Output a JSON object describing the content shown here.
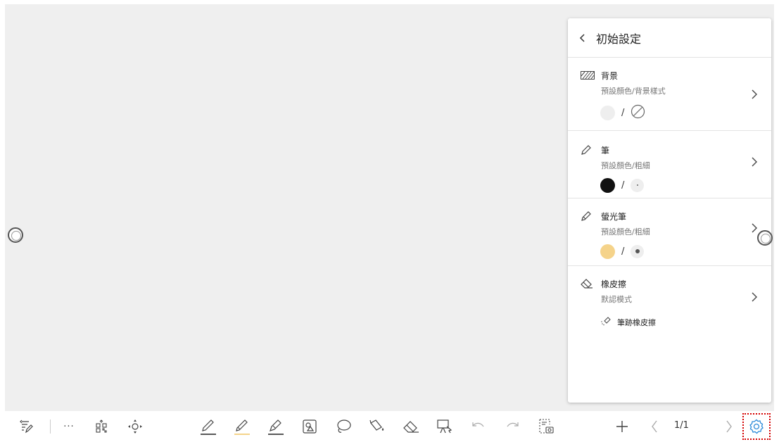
{
  "panel": {
    "title": "初始設定",
    "background": {
      "title": "背景",
      "subtitle": "預設顏色/背景樣式",
      "slash": "/"
    },
    "pen": {
      "title": "筆",
      "subtitle": "預設顏色/粗細",
      "slash": "/"
    },
    "highlighter": {
      "title": "螢光筆",
      "subtitle": "預設顏色/粗細",
      "slash": "/"
    },
    "eraser": {
      "title": "橡皮擦",
      "subtitle": "默認模式",
      "option": "筆跡橡皮擦"
    }
  },
  "toolbar": {
    "page_indicator": "1/1",
    "more_label": "···"
  },
  "colors": {
    "pen": "#111111",
    "highlighter": "#f5d38a",
    "background_swatch": "#eeeeee",
    "focus": "#d40000"
  },
  "icons": [
    "back-icon",
    "background-pattern-icon",
    "pen-icon",
    "highlighter-icon",
    "eraser-icon",
    "chevron-right-icon",
    "stroke-eraser-icon",
    "note-icon",
    "more-icon",
    "qr-code-icon",
    "move-icon",
    "pen-tool-icon",
    "highlighter-tool-icon",
    "marker-tool-icon",
    "shape-icon",
    "lasso-icon",
    "fill-icon",
    "eraser-tool-icon",
    "presentation-icon",
    "undo-icon",
    "redo-icon",
    "screenshot-icon",
    "add-page-icon",
    "prev-page-icon",
    "next-page-icon",
    "settings-icon"
  ]
}
